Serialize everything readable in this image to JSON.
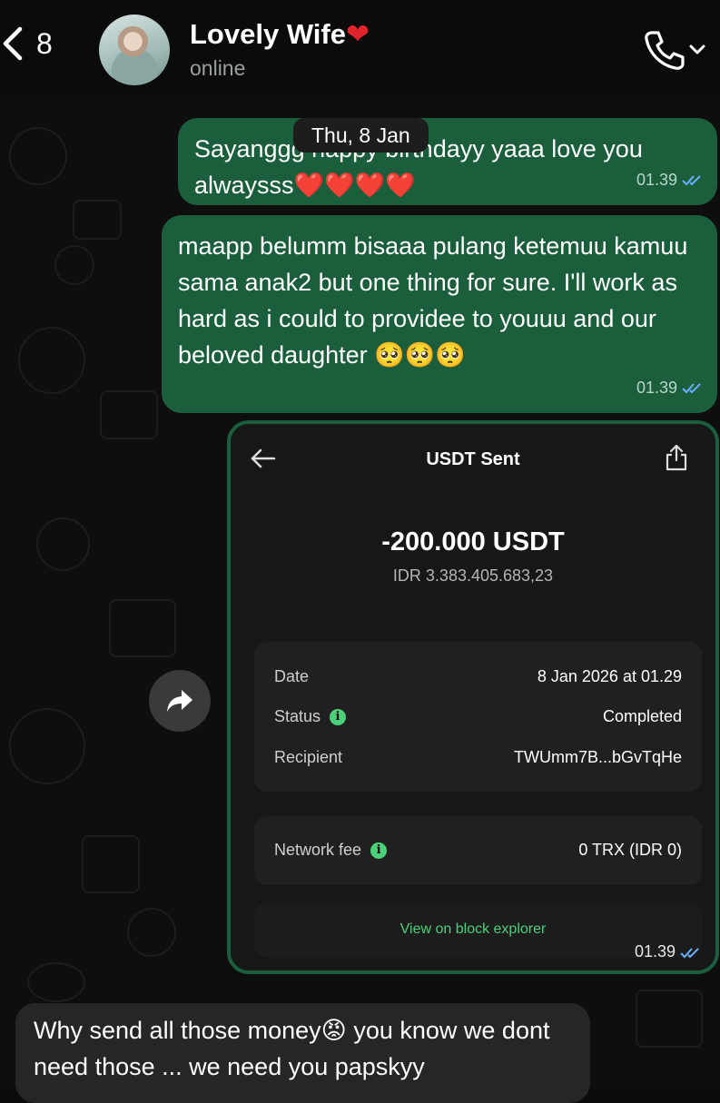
{
  "header": {
    "back_count": "8",
    "contact_name": "Lovely Wife",
    "contact_status": "online"
  },
  "date_chip": "Thu, 8 Jan",
  "messages": [
    {
      "text_before": "Sayanggg happy birthdayy yaaa love you alwaysss",
      "emoji": "❤️❤️❤️❤️",
      "time": "01.39"
    },
    {
      "text": "maapp belumm bisaaa pulang ketemuu kamuu sama anak2 but one thing for sure. I'll work as hard as i could to providee to youuu and our beloved daughter",
      "emoji": "🥺🥺🥺",
      "time": "01.39"
    }
  ],
  "transaction": {
    "title": "USDT Sent",
    "amount": "-200.000 USDT",
    "amount_idr": "IDR 3.383.405.683,23",
    "details": {
      "date_label": "Date",
      "date_value": "8 Jan 2026 at 01.29",
      "status_label": "Status",
      "status_value": "Completed",
      "recipient_label": "Recipient",
      "recipient_value": "TWUmm7B...bGvTqHe"
    },
    "fee": {
      "label": "Network fee",
      "value": "0 TRX (IDR 0)"
    },
    "explorer_link": "View on block explorer",
    "time": "01.39"
  },
  "incoming": {
    "text_part1": "Why send all those money",
    "emoji": "😡",
    "text_part2": "you know we dont need those ... we need you papskyy"
  },
  "colors": {
    "outgoing_bubble": "#1b5e3c",
    "incoming_bubble": "#262626",
    "accent_green": "#4cd07a",
    "read_ticks": "#6ab0ff"
  },
  "icons": [
    "back-chevron-icon",
    "phone-icon",
    "chevron-down-icon",
    "arrow-left-icon",
    "share-icon",
    "info-icon",
    "forward-icon",
    "double-check-icon"
  ]
}
